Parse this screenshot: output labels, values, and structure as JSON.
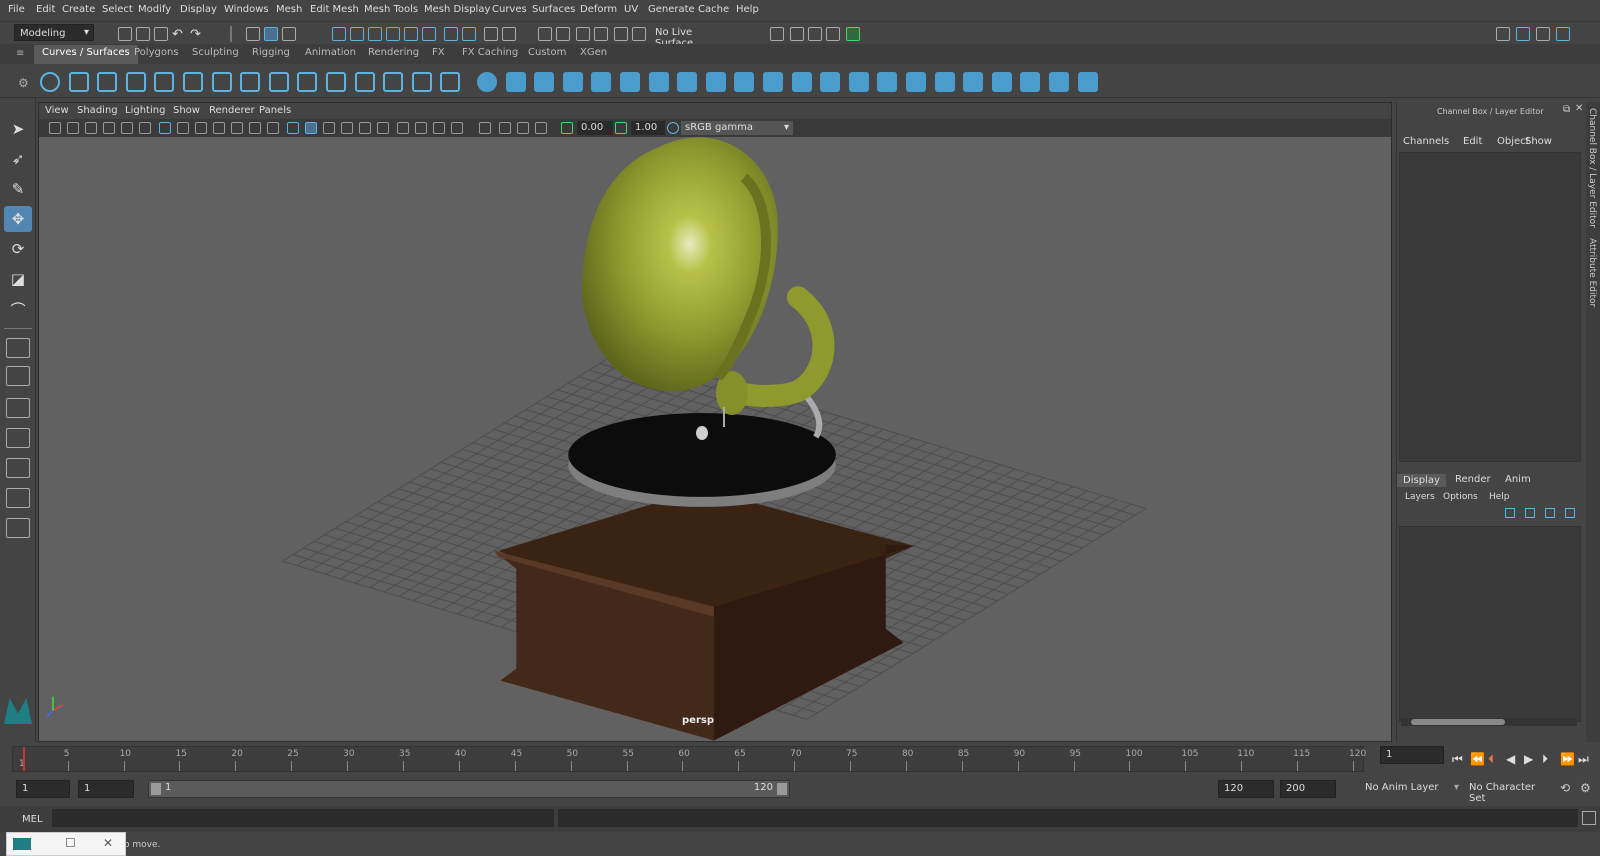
{
  "menubar": [
    "File",
    "Edit",
    "Create",
    "Select",
    "Modify",
    "Display",
    "Windows",
    "Mesh",
    "Edit Mesh",
    "Mesh Tools",
    "Mesh Display",
    "Curves",
    "Surfaces",
    "Deform",
    "UV",
    "Generate",
    "Cache",
    "Help"
  ],
  "status": {
    "mode": "Modeling",
    "live_surface": "No Live Surface"
  },
  "shelf_tabs": [
    "Curves / Surfaces",
    "Polygons",
    "Sculpting",
    "Rigging",
    "Animation",
    "Rendering",
    "FX",
    "FX Caching",
    "Custom",
    "XGen"
  ],
  "viewport": {
    "menu": [
      "View",
      "Shading",
      "Lighting",
      "Show",
      "Renderer",
      "Panels"
    ],
    "exposure": "0.00",
    "gamma": "1.00",
    "colorspace": "sRGB gamma",
    "camera_label": "persp",
    "colors": {
      "bg": "#616161",
      "horn": "#9aa33a",
      "wood": "#4a2a1a",
      "platter": "#0c0c0c"
    }
  },
  "right_panel": {
    "title": "Channel Box / Layer Editor",
    "channel_menu": [
      "Channels",
      "Edit",
      "Object",
      "Show"
    ],
    "layer_tabs": [
      "Display",
      "Render",
      "Anim"
    ],
    "layer_menu": [
      "Layers",
      "Options",
      "Help"
    ]
  },
  "side_strip": {
    "channel": "Channel Box / Layer Editor",
    "attr": "Attribute Editor"
  },
  "timeline": {
    "ticks": [
      "1",
      "5",
      "10",
      "15",
      "20",
      "25",
      "30",
      "35",
      "40",
      "45",
      "50",
      "55",
      "60",
      "65",
      "70",
      "75",
      "80",
      "85",
      "90",
      "95",
      "100",
      "105",
      "110",
      "115",
      "120"
    ],
    "current_frame": "1"
  },
  "range": {
    "start": "1",
    "playback_start": "1",
    "slider_start": "1",
    "slider_end": "120",
    "playback_end": "120",
    "end": "200",
    "anim_layer": "No Anim Layer",
    "char_set": "No Character Set"
  },
  "cmdline": {
    "label": "MEL"
  },
  "helpline": {
    "text": "o move."
  }
}
